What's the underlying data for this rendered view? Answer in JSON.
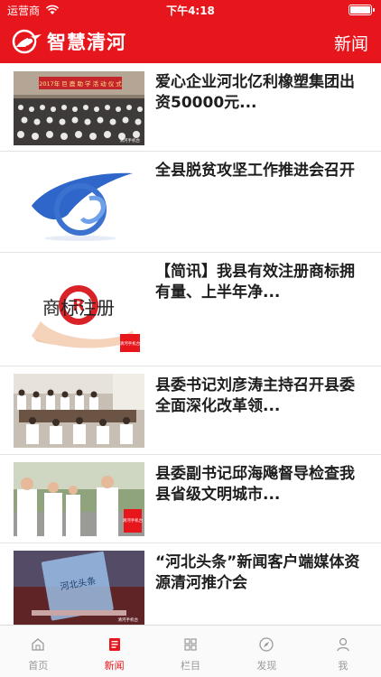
{
  "status_bar": {
    "carrier": "运营商",
    "time": "下午4:18"
  },
  "header": {
    "brand": "智慧清河",
    "section": "新闻"
  },
  "news": [
    {
      "title": "爱心企业河北亿利橡塑集团出资50000元...",
      "image_caption": "2017年 巨 鹿 助 学 活 动 仪 式",
      "watermark": "清河手机台"
    },
    {
      "title": "全县脱贫攻坚工作推进会召开"
    },
    {
      "title": "【简讯】我县有效注册商标拥有量、上半年净...",
      "image_caption": "商标注册",
      "stamp": "清河手机台"
    },
    {
      "title": "县委书记刘彦涛主持召开县委全面深化改革领..."
    },
    {
      "title": "县委副书记邱海飚督导检查我县省级文明城市...",
      "stamp": "清河手机台"
    },
    {
      "title": "“河北头条”新闻客户端媒体资源清河推介会",
      "image_caption": "河北头条",
      "watermark": "清河手机台"
    }
  ],
  "tabs": [
    {
      "label": "首页",
      "icon": "home-icon"
    },
    {
      "label": "新闻",
      "icon": "news-icon"
    },
    {
      "label": "栏目",
      "icon": "grid-icon"
    },
    {
      "label": "发现",
      "icon": "compass-icon"
    },
    {
      "label": "我",
      "icon": "user-icon"
    }
  ],
  "colors": {
    "brand_red": "#e7161c",
    "tab_inactive": "#9a9a9a"
  }
}
